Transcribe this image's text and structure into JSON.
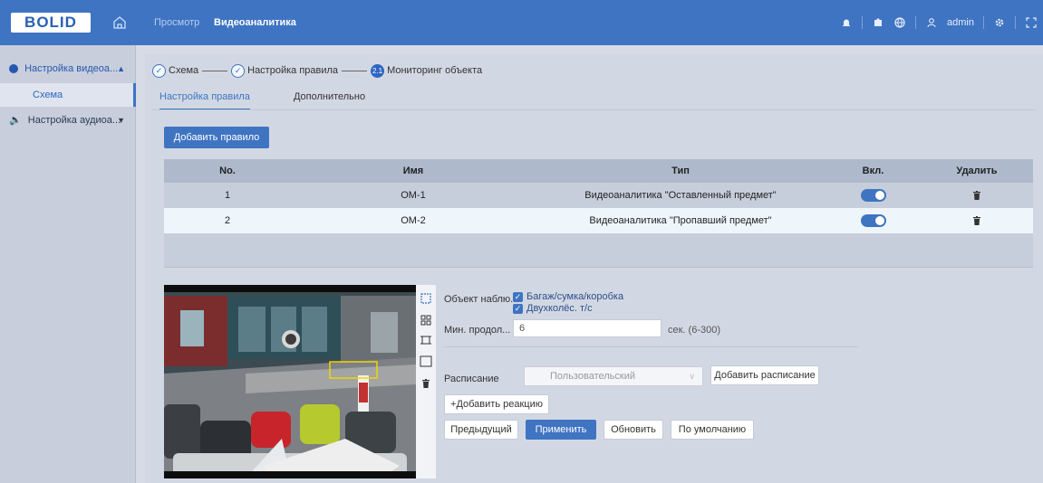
{
  "header": {
    "logo_text": "BOLID",
    "tabs": [
      {
        "label": "Просмотр"
      },
      {
        "label": "Видеоаналитика"
      }
    ],
    "user": "admin",
    "brand_color": "#3f74c2"
  },
  "sidebar": {
    "items": [
      {
        "label": "Настройка видеоа...",
        "icon": "video-analytics-icon",
        "expanded": true
      },
      {
        "label": "Схема"
      },
      {
        "label": "Настройка аудиоа...",
        "icon": "speaker-icon",
        "expanded": false
      }
    ]
  },
  "steps": [
    {
      "label": "Схема",
      "state": "done"
    },
    {
      "label": "Настройка правила",
      "state": "done"
    },
    {
      "label": "Мониторинг объекта",
      "state": "current",
      "number": "2.1"
    }
  ],
  "subtabs": [
    {
      "label": "Настройка правила",
      "active": true
    },
    {
      "label": "Дополнительно",
      "active": false
    }
  ],
  "add_rule_button": "Добавить правило",
  "table": {
    "headers": [
      "No.",
      "Имя",
      "Тип",
      "Вкл.",
      "Удалить"
    ],
    "rows": [
      {
        "no": "1",
        "name": "OM-1",
        "type": "Видеоаналитика \"Оставленный предмет\"",
        "enabled": true
      },
      {
        "no": "2",
        "name": "OM-2",
        "type": "Видеоаналитика \"Пропавший предмет\"",
        "enabled": true
      }
    ]
  },
  "form": {
    "object_label": "Объект наблю...",
    "objects": [
      {
        "label": "Багаж/сумка/коробка",
        "checked": true
      },
      {
        "label": "Двухколёс. т/с",
        "checked": true
      }
    ],
    "min_duration_label": "Мин. продол...",
    "min_duration_value": "6",
    "min_duration_hint": "сек. (6-300)",
    "schedule_label": "Расписание",
    "schedule_value": "Пользовательский",
    "add_schedule_button": "Добавить расписание",
    "add_reaction_button": "+Добавить реакцию",
    "buttons": {
      "prev": "Предыдущий",
      "apply": "Применить",
      "refresh": "Обновить",
      "default": "По умолчанию"
    }
  }
}
